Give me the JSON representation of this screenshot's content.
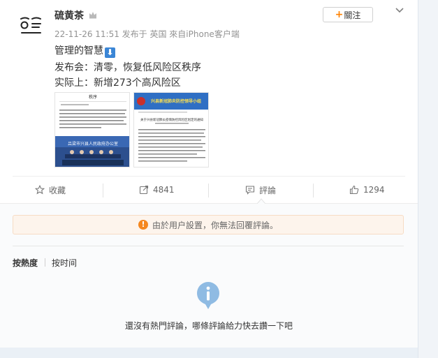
{
  "post": {
    "username": "硫黄茶",
    "meta": "22-11-26 11:51 发布于 英国 來自iPhone客户端",
    "follow_label": "關注",
    "lines": [
      "管理的智慧",
      "发布会：清零，恢复低风险区秩序",
      "实际上：新增273个高风险区"
    ],
    "arrow_emoji": "⬇"
  },
  "thumbnails": {
    "left_header": "秩序",
    "left_banner": "吕梁市兴县人民政府办公室",
    "right_banner": "兴县新冠肺炎防控领导小组",
    "right_title": "关于兴县新冠肺炎疫情防控风险区划定的通知"
  },
  "actions": {
    "favorite": "收藏",
    "repost": "4841",
    "comment": "評論",
    "like": "1294"
  },
  "notice": {
    "text": "由於用户設置，你無法回覆評論。"
  },
  "sort": {
    "hot": "按熱度",
    "time": "按时间"
  },
  "empty": {
    "text": "還沒有熱門評論，哪條評論給力快去讚一下吧"
  },
  "colors": {
    "accent_orange": "#ff8200",
    "notice_icon": "#f5871f",
    "empty_icon": "#8fbbe3",
    "emoji_blue": "#3b86d6"
  }
}
